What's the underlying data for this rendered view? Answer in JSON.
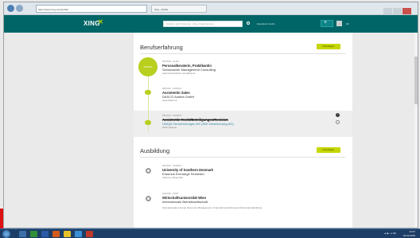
{
  "browser": {
    "address": "https://www.xing.com/profile/",
    "tab_title": "Xing - Profile",
    "window_controls": [
      "minimize-icon",
      "maximize-icon",
      "close-icon"
    ]
  },
  "xing": {
    "logo": "XING",
    "search_placeholder": "Suchen nach Personen, Jobs, Unternehmen...",
    "filter_label": "Erweiterte Suche",
    "plus_label": "+",
    "user_label": "Ich",
    "brand_color": "#006567",
    "accent_color": "#b9cf1e"
  },
  "berufserfahrung": {
    "title": "Berufserfahrung",
    "add_label": "hinzufügen",
    "circle_label": "01/2015",
    "entries": [
      {
        "date": "01/2015 - heute",
        "title": "Personalberaterin, Praktikantin",
        "company": "Schumacher Management Consulting",
        "location": "www.schumacher-consulting.at"
      },
      {
        "date": "08/2014 - 09/2014",
        "title": "Assistentin Sales",
        "company": "DASCO Austria GmbH",
        "location": "www.dasco.at"
      },
      {
        "date": "03/2013 - 05/2013",
        "title": "Assistentin Recht/Beteiligungen/Revision",
        "company": "UNIQA Versicherungen AG (NW Versicherung AG)",
        "location": "www.uniqa.at"
      }
    ]
  },
  "ausbildung": {
    "title": "Ausbildung",
    "add_label": "hinzufügen",
    "entries": [
      {
        "date": "02/2014 - 06/2014",
        "title": "University of Southern Denmark",
        "company": "Erasmus Exchange Semester",
        "location": "Odense, Dänemark"
      },
      {
        "date": "10/2010 - 2015",
        "title": "Wirtschaftsuniversität Wien",
        "company": "Internationale Betriebswirtschaft",
        "description": "Internationales Human Resource Management, Unternehmensführung & Personalentwicklung"
      }
    ]
  },
  "taskbar": {
    "time": "13:37",
    "date": "04.03.2015",
    "tray": "▲ ▶ ▪ ◂ DE"
  }
}
